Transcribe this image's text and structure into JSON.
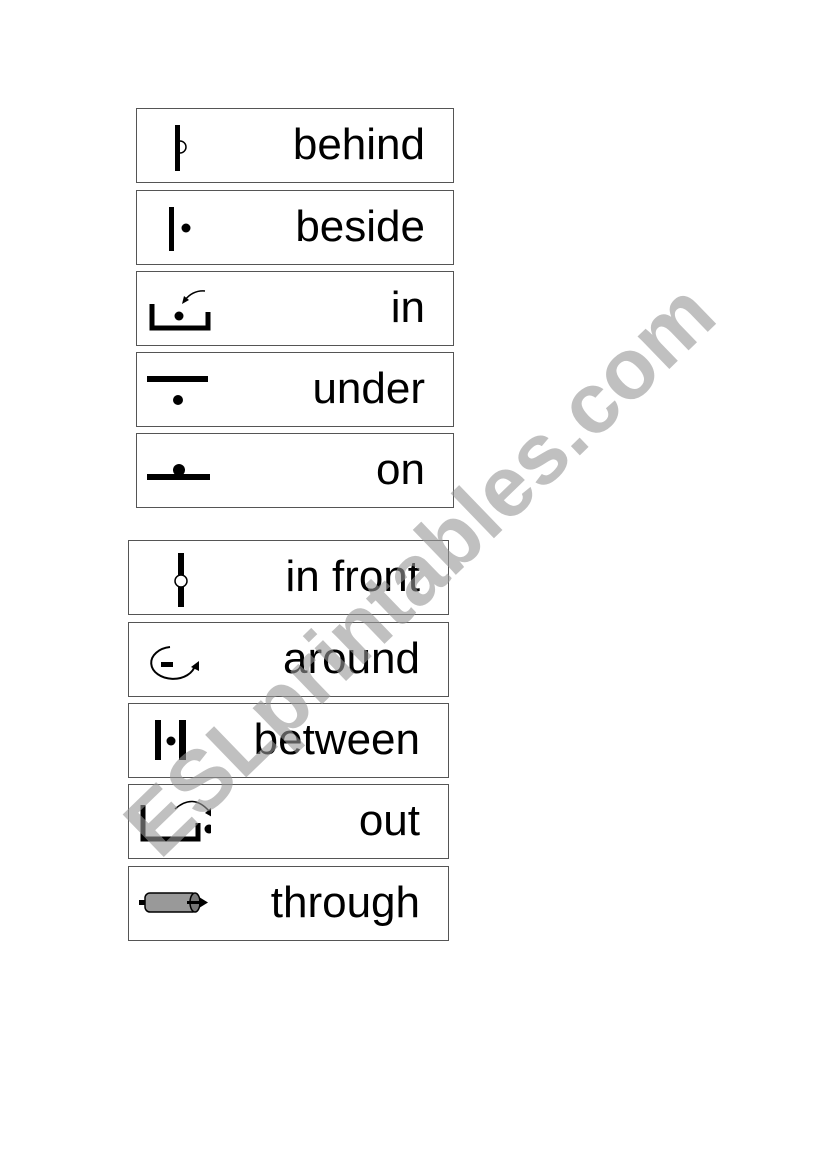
{
  "cards_group_1": [
    {
      "word": "behind",
      "icon": "behind-icon"
    },
    {
      "word": "beside",
      "icon": "beside-icon"
    },
    {
      "word": "in",
      "icon": "in-icon"
    },
    {
      "word": "under",
      "icon": "under-icon"
    },
    {
      "word": "on",
      "icon": "on-icon"
    }
  ],
  "cards_group_2": [
    {
      "word": "in front",
      "icon": "in-front-icon"
    },
    {
      "word": "around",
      "icon": "around-icon"
    },
    {
      "word": "between",
      "icon": "between-icon"
    },
    {
      "word": "out",
      "icon": "out-icon"
    },
    {
      "word": "through",
      "icon": "through-icon"
    }
  ],
  "watermark": "ESLprintables.com",
  "colors": {
    "border": "#555555",
    "watermark": "#969696",
    "cylinder": "#999999"
  }
}
